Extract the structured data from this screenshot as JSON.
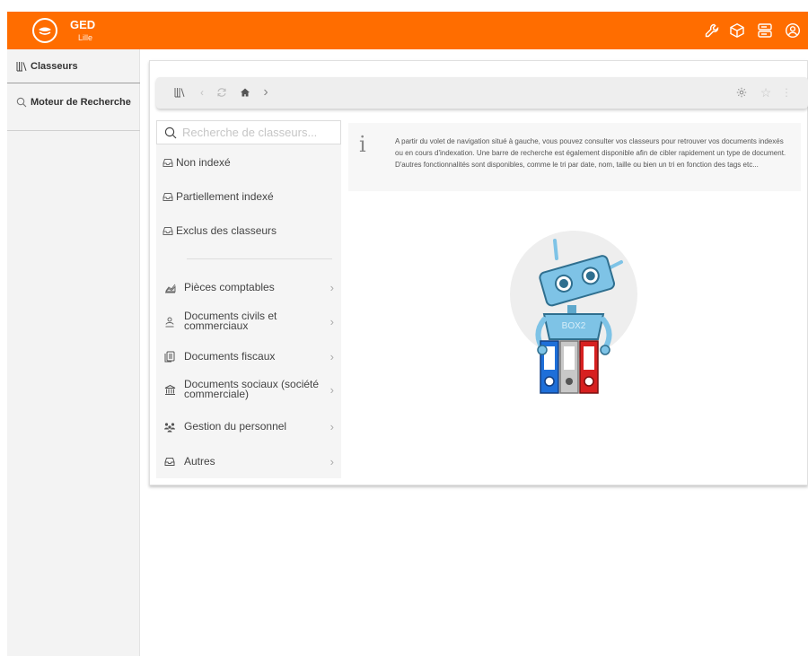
{
  "topbar": {
    "title": "GED",
    "subtitle": "Lille",
    "background": "#ff6d00",
    "icons": [
      "wrench-icon",
      "cube-icon",
      "server-icon",
      "user-circle-icon"
    ]
  },
  "sidebar": {
    "items": [
      {
        "label": "Classeurs",
        "icon": "library-icon"
      },
      {
        "label": "Moteur de Recherche",
        "icon": "search-icon"
      }
    ]
  },
  "toolbar": {
    "icons": [
      "library-icon",
      "chevron-left-icon",
      "refresh-icon",
      "home-icon",
      "chevron-right-icon",
      "gear-icon",
      "star-icon",
      "more-vertical-icon"
    ]
  },
  "tree": {
    "search_placeholder": "Recherche de classeurs...",
    "top_items": [
      {
        "label": "Non indexé",
        "icon": "inbox-icon"
      },
      {
        "label": "Partiellement indexé",
        "icon": "inbox-icon"
      },
      {
        "label": "Exclus des classeurs",
        "icon": "inbox-icon"
      }
    ],
    "categories": [
      {
        "label": "Pièces comptables",
        "icon": "chart-area-icon"
      },
      {
        "label": "Documents civils et commerciaux",
        "icon": "users-icon"
      },
      {
        "label": "Documents fiscaux",
        "icon": "files-icon"
      },
      {
        "label": "Documents sociaux (société commerciale)",
        "icon": "bank-icon"
      },
      {
        "label": "Gestion du personnel",
        "icon": "group-icon"
      },
      {
        "label": "Autres",
        "icon": "inbox-icon"
      }
    ]
  },
  "info": {
    "text": "A partir du volet de navigation situé à gauche, vous pouvez consulter vos classeurs pour retrouver vos documents indexés ou en cours d'indexation. Une barre de recherche est également disponible afin de cibler rapidement un type de document. D'autres fonctionnalités sont disponibles, comme le tri par date, nom, taille ou bien un tri en fonction des tags etc..."
  },
  "illustration": {
    "robot_label": "BOX2",
    "colors": {
      "robot": "#7ec3e6",
      "circle": "#eeeeee",
      "blue_binder": "#1e6fd9",
      "gray_binder": "#c8c8c8",
      "red_binder": "#d72020"
    }
  }
}
